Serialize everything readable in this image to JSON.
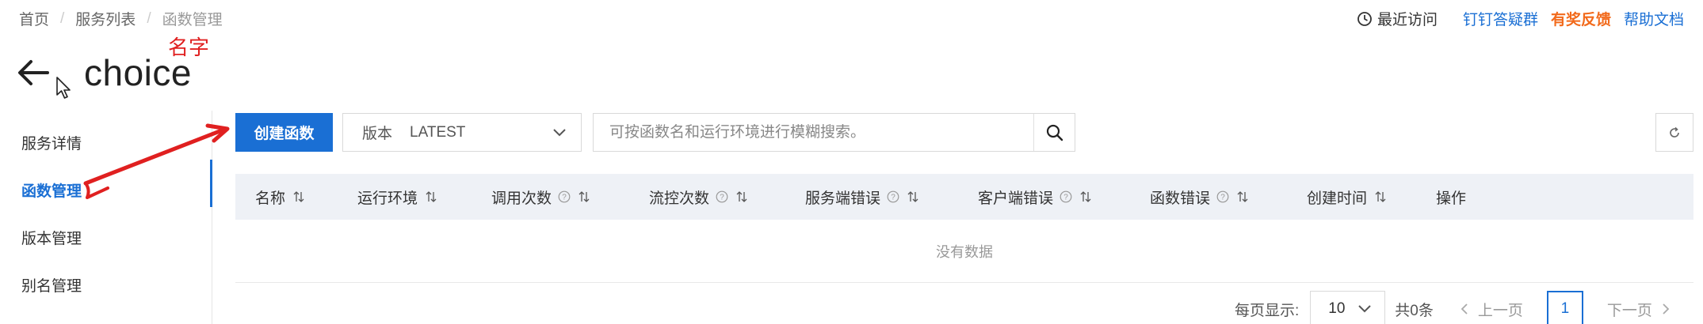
{
  "breadcrumb": [
    "首页",
    "服务列表",
    "函数管理"
  ],
  "top_links": {
    "recent": "最近访问",
    "dingtalk": "钉钉答疑群",
    "feedback": "有奖反馈",
    "help": "帮助文档"
  },
  "title": "choice",
  "annotation": "名字",
  "sidebar": {
    "items": [
      {
        "label": "服务详情"
      },
      {
        "label": "函数管理",
        "active": true
      },
      {
        "label": "版本管理"
      },
      {
        "label": "别名管理"
      }
    ]
  },
  "toolbar": {
    "create_label": "创建函数",
    "version_label": "版本",
    "version_value": "LATEST",
    "search_placeholder": "可按函数名和运行环境进行模糊搜索。"
  },
  "table": {
    "columns": [
      {
        "label": "名称",
        "help": false,
        "sort": true
      },
      {
        "label": "运行环境",
        "help": false,
        "sort": true
      },
      {
        "label": "调用次数",
        "help": true,
        "sort": true
      },
      {
        "label": "流控次数",
        "help": true,
        "sort": true
      },
      {
        "label": "服务端错误",
        "help": true,
        "sort": true
      },
      {
        "label": "客户端错误",
        "help": true,
        "sort": true
      },
      {
        "label": "函数错误",
        "help": true,
        "sort": true
      },
      {
        "label": "创建时间",
        "help": false,
        "sort": true
      },
      {
        "label": "操作",
        "help": false,
        "sort": false
      }
    ],
    "empty_text": "没有数据"
  },
  "pagination": {
    "per_page_label": "每页显示:",
    "per_page_value": "10",
    "total": "共0条",
    "prev": "上一页",
    "current_page": "1",
    "next": "下一页"
  },
  "colors": {
    "primary": "#1a6fd4",
    "feedback": "#f26a1b",
    "annotation": "#e02020"
  }
}
